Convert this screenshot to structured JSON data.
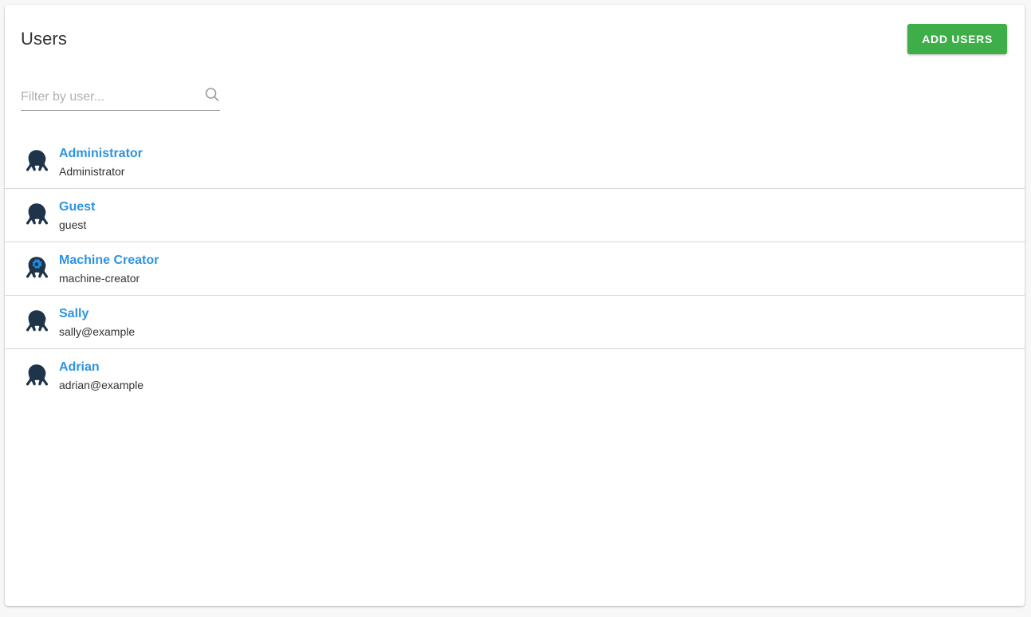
{
  "header": {
    "title": "Users",
    "add_users_label": "ADD USERS",
    "add_users_color": "#3eae49"
  },
  "filter": {
    "placeholder": "Filter by user...",
    "value": "",
    "icon": "search-icon"
  },
  "colors": {
    "link": "#2f93e0",
    "avatar": "#1f3449",
    "gear": "#1f8ce0",
    "divider": "#d8d8d8",
    "background": "#f7f7f7",
    "card": "#ffffff"
  },
  "users": [
    {
      "name": "Administrator",
      "sub": "Administrator",
      "avatar_icon": "octopus-avatar-icon",
      "is_service_account": false
    },
    {
      "name": "Guest",
      "sub": "guest",
      "avatar_icon": "octopus-avatar-icon",
      "is_service_account": false
    },
    {
      "name": "Machine Creator",
      "sub": "machine-creator",
      "avatar_icon": "octopus-service-account-avatar-icon",
      "is_service_account": true
    },
    {
      "name": "Sally",
      "sub": "sally@example",
      "avatar_icon": "octopus-avatar-icon",
      "is_service_account": false
    },
    {
      "name": "Adrian",
      "sub": "adrian@example",
      "avatar_icon": "octopus-avatar-icon",
      "is_service_account": false
    }
  ]
}
